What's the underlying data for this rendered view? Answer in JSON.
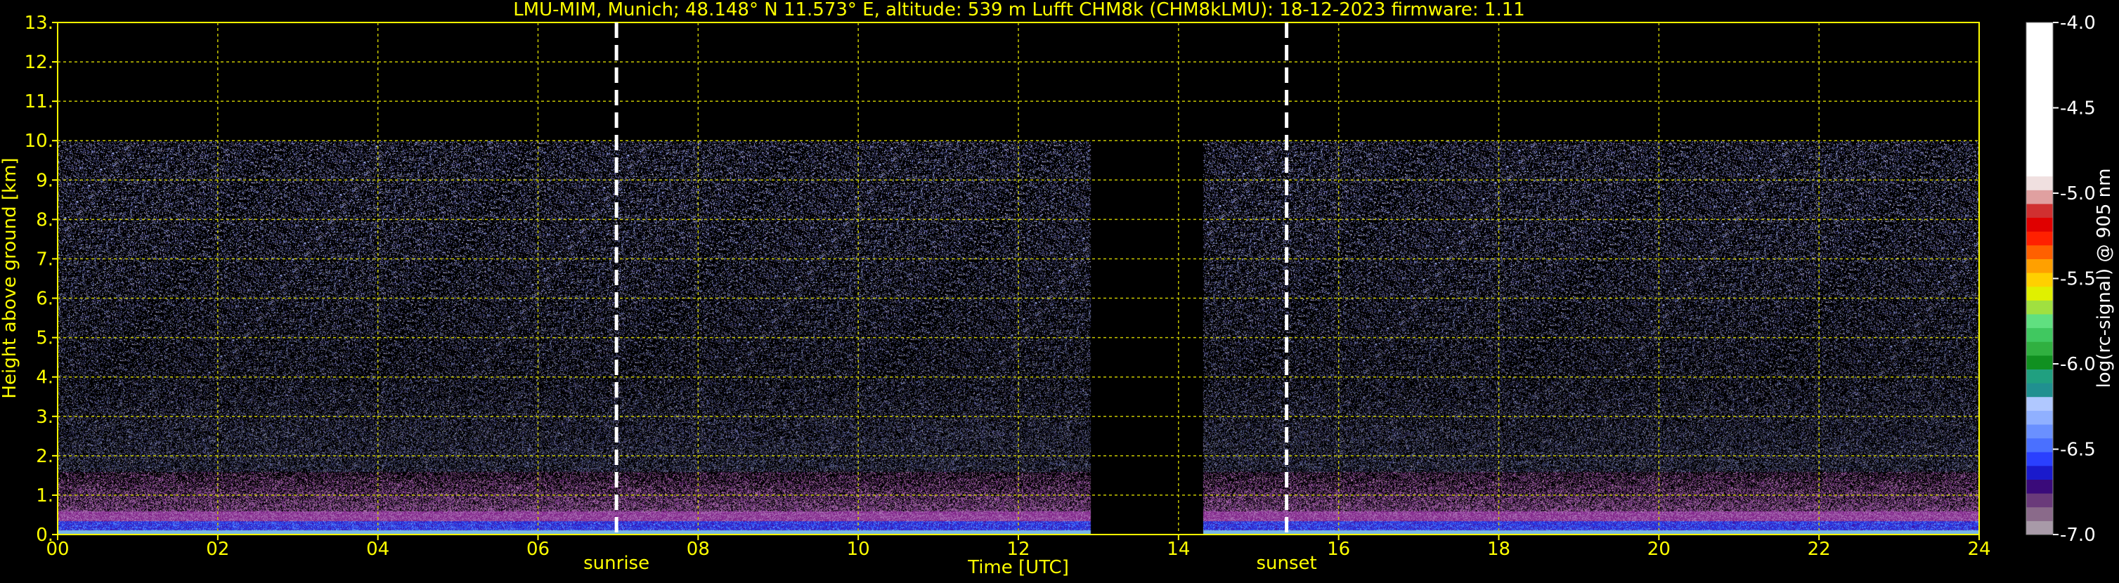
{
  "chart_data": {
    "type": "heatmap",
    "title": "LMU-MIM, Munich; 48.148° N 11.573° E, altitude: 539 m    Lufft CHM8k (CHM8kLMU): 18-12-2023    firmware: 1.11",
    "xlabel": "Time [UTC]",
    "ylabel": "Height above ground [km]",
    "xlim": [
      0,
      24
    ],
    "ylim": [
      0,
      13
    ],
    "x_ticks": [
      0,
      2,
      4,
      6,
      8,
      10,
      12,
      14,
      16,
      18,
      20,
      22,
      24
    ],
    "x_tick_labels": [
      "00",
      "02",
      "04",
      "06",
      "08",
      "10",
      "12",
      "14",
      "16",
      "18",
      "20",
      "22",
      "24"
    ],
    "y_ticks": [
      0,
      1,
      2,
      3,
      4,
      5,
      6,
      7,
      8,
      9,
      10,
      11,
      12,
      13
    ],
    "y_tick_labels": [
      "0.",
      "1.",
      "2.",
      "3.",
      "4.",
      "5.",
      "6.",
      "7.",
      "8.",
      "9.",
      "10.",
      "11.",
      "12.",
      "13."
    ],
    "grid": true,
    "data_top_km": 10,
    "data_gap_hours": [
      12.9,
      14.3
    ],
    "annotations": [
      {
        "label": "sunrise",
        "x": 6.98
      },
      {
        "label": "sunset",
        "x": 15.35
      }
    ],
    "colorbar": {
      "label": "log(rc-signal) @ 905 nm",
      "range": [
        -7.0,
        -4.0
      ],
      "tick_values": [
        -4.0,
        -4.5,
        -5.0,
        -5.5,
        -6.0,
        -6.5,
        -7.0
      ],
      "tick_labels": [
        "-4.0",
        "-4.5",
        "-5.0",
        "-5.5",
        "-6.0",
        "-6.5",
        "-7.0"
      ],
      "colors": [
        "#a89aa8",
        "#8a6a8a",
        "#6a3a7a",
        "#3a0a7a",
        "#1a1acc",
        "#2a40ff",
        "#4a70ff",
        "#6a90ff",
        "#90b0ff",
        "#b0c8ff",
        "#209090",
        "#20a080",
        "#109020",
        "#30b040",
        "#40c860",
        "#60e080",
        "#a0e040",
        "#e0f000",
        "#ffd000",
        "#ffa000",
        "#ff6000",
        "#ff2000",
        "#e00000",
        "#d03030",
        "#e0a0a0",
        "#f0e0e0",
        "#ffffff"
      ]
    },
    "profile": {
      "description_free": true,
      "layers": [
        {
          "from_km": 0.0,
          "to_km": 0.15,
          "level": -5.9,
          "label_free": true
        },
        {
          "from_km": 0.15,
          "to_km": 0.35,
          "level": -6.4
        },
        {
          "from_km": 0.35,
          "to_km": 0.55,
          "level": -6.75
        },
        {
          "from_km": 0.55,
          "to_km": 1.0,
          "level": -6.9
        }
      ]
    },
    "colors": {
      "text": "#ffff00",
      "grid": "#c8c800",
      "marker": "#ffffff"
    }
  }
}
